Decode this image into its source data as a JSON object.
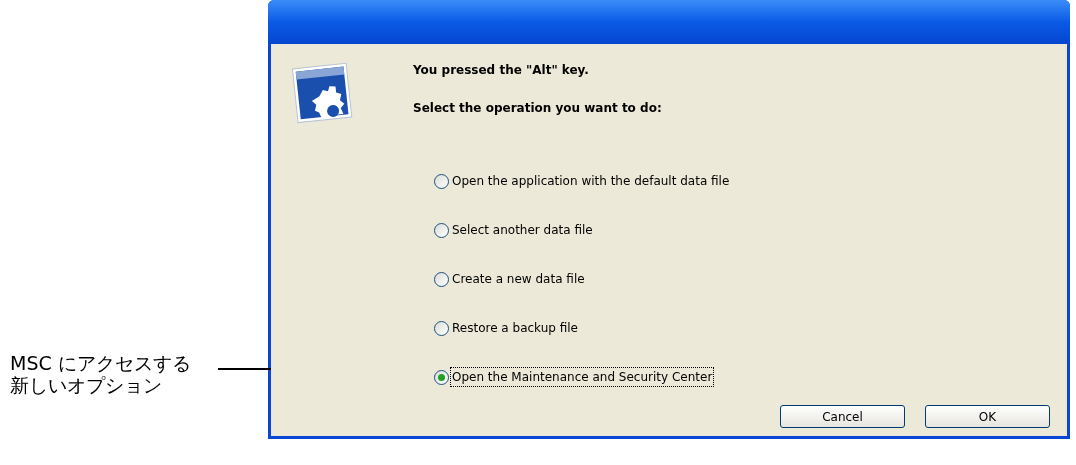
{
  "callout": {
    "lines": [
      "MSC にアクセスする",
      "新しいオプション"
    ]
  },
  "dialog": {
    "messages": [
      "You pressed the \"Alt\" key.",
      "Select the operation you want to do:"
    ],
    "options": [
      {
        "label": "Open the application with the default data file",
        "selected": false
      },
      {
        "label": "Select another data file",
        "selected": false
      },
      {
        "label": "Create a new data file",
        "selected": false
      },
      {
        "label": "Restore a backup file",
        "selected": false
      },
      {
        "label": "Open the Maintenance and Security Center",
        "selected": true
      }
    ],
    "buttons": [
      "Cancel",
      "OK"
    ]
  }
}
